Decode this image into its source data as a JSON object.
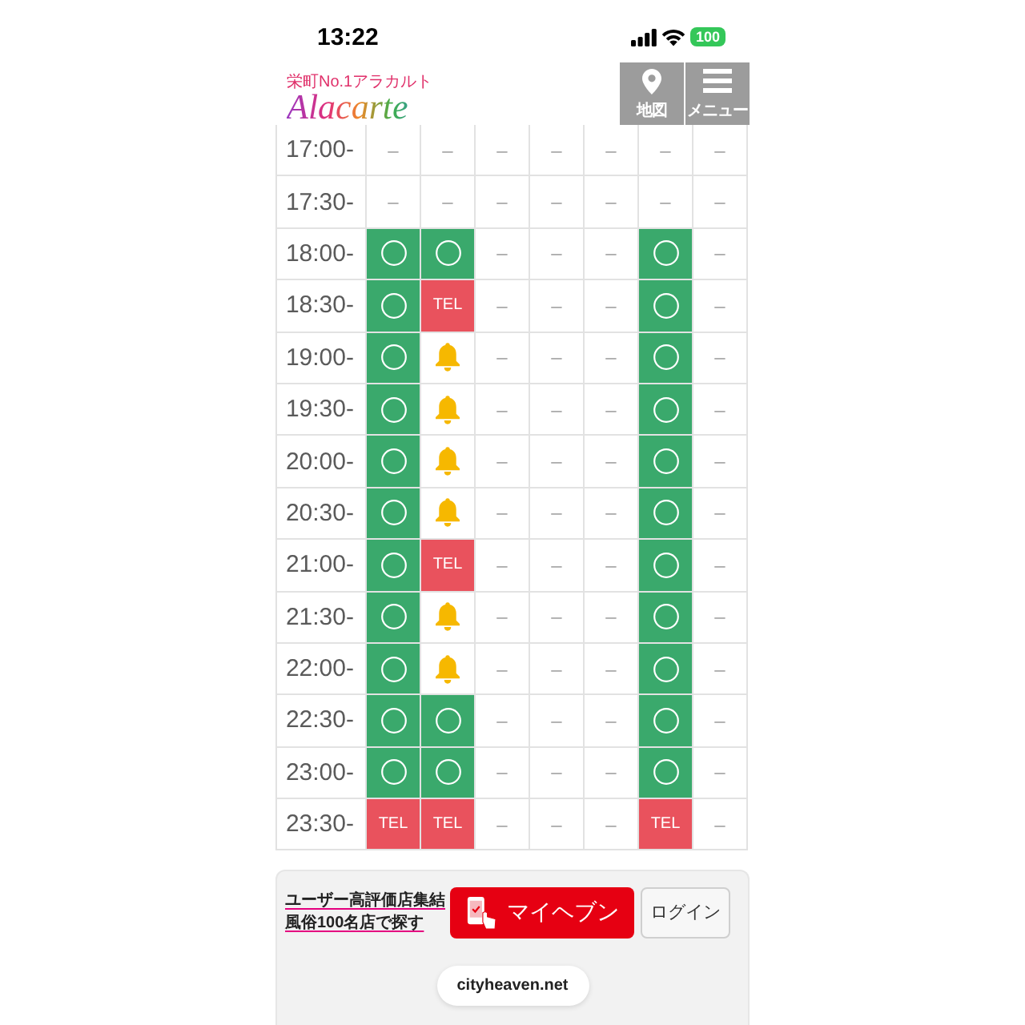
{
  "status_bar": {
    "time": "13:22",
    "battery": "100"
  },
  "header": {
    "logo": {
      "tagline": "栄町No.1アラカルト",
      "name": "Alacarte"
    },
    "buttons": [
      {
        "kind": "map",
        "label": "地図"
      },
      {
        "kind": "menu",
        "label": "メニュー"
      }
    ]
  },
  "schedule": {
    "rows": [
      {
        "time": "17:00-",
        "cells": [
          {
            "kind": "none",
            "text": "–"
          },
          {
            "kind": "none",
            "text": "–"
          },
          {
            "kind": "none",
            "text": "–"
          },
          {
            "kind": "none",
            "text": "–"
          },
          {
            "kind": "none",
            "text": "–"
          },
          {
            "kind": "none",
            "text": "–"
          },
          {
            "kind": "none",
            "text": "–"
          }
        ]
      },
      {
        "time": "17:30-",
        "cells": [
          {
            "kind": "none",
            "text": "–"
          },
          {
            "kind": "none",
            "text": "–"
          },
          {
            "kind": "none",
            "text": "–"
          },
          {
            "kind": "none",
            "text": "–"
          },
          {
            "kind": "none",
            "text": "–"
          },
          {
            "kind": "none",
            "text": "–"
          },
          {
            "kind": "none",
            "text": "–"
          }
        ]
      },
      {
        "time": "18:00-",
        "cells": [
          {
            "kind": "open"
          },
          {
            "kind": "open"
          },
          {
            "kind": "none",
            "text": "–"
          },
          {
            "kind": "none",
            "text": "–"
          },
          {
            "kind": "none",
            "text": "–"
          },
          {
            "kind": "open"
          },
          {
            "kind": "none",
            "text": "–"
          }
        ]
      },
      {
        "time": "18:30-",
        "cells": [
          {
            "kind": "open"
          },
          {
            "kind": "tel",
            "text": "TEL"
          },
          {
            "kind": "none",
            "text": "–"
          },
          {
            "kind": "none",
            "text": "–"
          },
          {
            "kind": "none",
            "text": "–"
          },
          {
            "kind": "open"
          },
          {
            "kind": "none",
            "text": "–"
          }
        ]
      },
      {
        "time": "19:00-",
        "cells": [
          {
            "kind": "open"
          },
          {
            "kind": "bell"
          },
          {
            "kind": "none",
            "text": "–"
          },
          {
            "kind": "none",
            "text": "–"
          },
          {
            "kind": "none",
            "text": "–"
          },
          {
            "kind": "open"
          },
          {
            "kind": "none",
            "text": "–"
          }
        ]
      },
      {
        "time": "19:30-",
        "cells": [
          {
            "kind": "open"
          },
          {
            "kind": "bell"
          },
          {
            "kind": "none",
            "text": "–"
          },
          {
            "kind": "none",
            "text": "–"
          },
          {
            "kind": "none",
            "text": "–"
          },
          {
            "kind": "open"
          },
          {
            "kind": "none",
            "text": "–"
          }
        ]
      },
      {
        "time": "20:00-",
        "cells": [
          {
            "kind": "open"
          },
          {
            "kind": "bell"
          },
          {
            "kind": "none",
            "text": "–"
          },
          {
            "kind": "none",
            "text": "–"
          },
          {
            "kind": "none",
            "text": "–"
          },
          {
            "kind": "open"
          },
          {
            "kind": "none",
            "text": "–"
          }
        ]
      },
      {
        "time": "20:30-",
        "cells": [
          {
            "kind": "open"
          },
          {
            "kind": "bell"
          },
          {
            "kind": "none",
            "text": "–"
          },
          {
            "kind": "none",
            "text": "–"
          },
          {
            "kind": "none",
            "text": "–"
          },
          {
            "kind": "open"
          },
          {
            "kind": "none",
            "text": "–"
          }
        ]
      },
      {
        "time": "21:00-",
        "cells": [
          {
            "kind": "open"
          },
          {
            "kind": "tel",
            "text": "TEL"
          },
          {
            "kind": "none",
            "text": "–"
          },
          {
            "kind": "none",
            "text": "–"
          },
          {
            "kind": "none",
            "text": "–"
          },
          {
            "kind": "open"
          },
          {
            "kind": "none",
            "text": "–"
          }
        ]
      },
      {
        "time": "21:30-",
        "cells": [
          {
            "kind": "open"
          },
          {
            "kind": "bell"
          },
          {
            "kind": "none",
            "text": "–"
          },
          {
            "kind": "none",
            "text": "–"
          },
          {
            "kind": "none",
            "text": "–"
          },
          {
            "kind": "open"
          },
          {
            "kind": "none",
            "text": "–"
          }
        ]
      },
      {
        "time": "22:00-",
        "cells": [
          {
            "kind": "open"
          },
          {
            "kind": "bell"
          },
          {
            "kind": "none",
            "text": "–"
          },
          {
            "kind": "none",
            "text": "–"
          },
          {
            "kind": "none",
            "text": "–"
          },
          {
            "kind": "open"
          },
          {
            "kind": "none",
            "text": "–"
          }
        ]
      },
      {
        "time": "22:30-",
        "cells": [
          {
            "kind": "open"
          },
          {
            "kind": "open"
          },
          {
            "kind": "none",
            "text": "–"
          },
          {
            "kind": "none",
            "text": "–"
          },
          {
            "kind": "none",
            "text": "–"
          },
          {
            "kind": "open"
          },
          {
            "kind": "none",
            "text": "–"
          }
        ]
      },
      {
        "time": "23:00-",
        "cells": [
          {
            "kind": "open"
          },
          {
            "kind": "open"
          },
          {
            "kind": "none",
            "text": "–"
          },
          {
            "kind": "none",
            "text": "–"
          },
          {
            "kind": "none",
            "text": "–"
          },
          {
            "kind": "open"
          },
          {
            "kind": "none",
            "text": "–"
          }
        ]
      },
      {
        "time": "23:30-",
        "cells": [
          {
            "kind": "tel",
            "text": "TEL"
          },
          {
            "kind": "tel",
            "text": "TEL"
          },
          {
            "kind": "none",
            "text": "–"
          },
          {
            "kind": "none",
            "text": "–"
          },
          {
            "kind": "none",
            "text": "–"
          },
          {
            "kind": "tel",
            "text": "TEL"
          },
          {
            "kind": "none",
            "text": "–"
          }
        ]
      }
    ]
  },
  "footer": {
    "links": [
      "ユーザー高評価店集結",
      "風俗100名店で探す"
    ],
    "myheaven_button": "マイヘブン",
    "login_button": "ログイン",
    "domain": "cityheaven.net"
  }
}
